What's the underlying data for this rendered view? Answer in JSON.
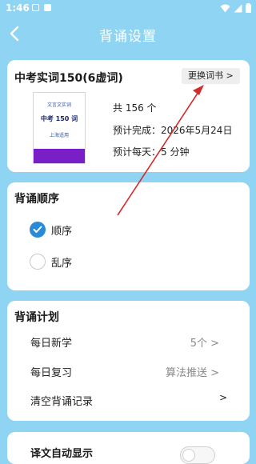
{
  "status_bar": {
    "time": "1:46"
  },
  "header": {
    "title": "背诵设置"
  },
  "book": {
    "title": "中考实词150(6虚词)",
    "change_label": "更换词书 >",
    "cover": {
      "top_text": "文言文实词",
      "main_text": "中考 150 词",
      "sub_text": "上海适用"
    },
    "total": "共 156 个",
    "expected_finish": "预计完成：2026年5月24日",
    "daily_time": "预计每天：5 分钟"
  },
  "order": {
    "title": "背诵顺序",
    "options": [
      {
        "label": "顺序",
        "checked": true
      },
      {
        "label": "乱序",
        "checked": false
      }
    ]
  },
  "plan": {
    "title": "背诵计划",
    "rows": [
      {
        "label": "每日新学",
        "value": "5个 >",
        "arrow": ""
      },
      {
        "label": "每日复习",
        "value": "算法推送 >",
        "arrow": ""
      },
      {
        "label": "清空背诵记录",
        "value": "",
        "arrow": ">"
      }
    ]
  },
  "auto_show": {
    "label": "译文自动显示",
    "enabled": false
  },
  "colors": {
    "background": "#8fd4f2",
    "accent": "#2a8ad8",
    "cover_band": "#7a1fc7",
    "annotation": "#d22b2b"
  }
}
